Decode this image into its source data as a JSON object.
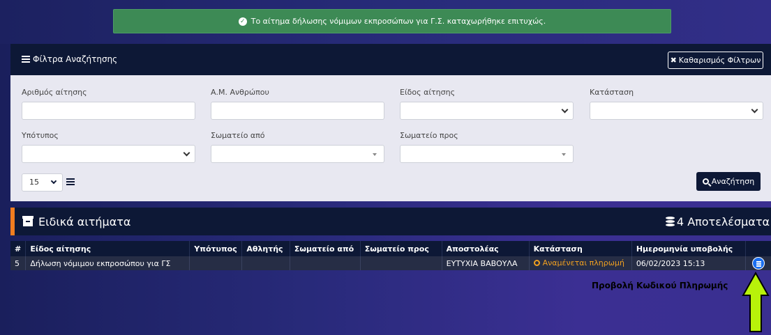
{
  "alert": {
    "message": "Το αίτημα δήλωσης νόμιμων εκπροσώπων για Γ.Σ. καταχωρήθηκε επιτυχώς.",
    "color": "#3d8a55"
  },
  "filters": {
    "title": "Φίλτρα Αναζήτησης",
    "clear_label": "Καθαρισμός Φίλτρων",
    "fields": {
      "request_number": {
        "label": "Αριθμός αίτησης",
        "value": ""
      },
      "person_id": {
        "label": "Α.Μ. Ανθρώπου",
        "value": ""
      },
      "request_type": {
        "label": "Είδος αίτησης",
        "value": ""
      },
      "status": {
        "label": "Κατάσταση",
        "value": ""
      },
      "subtype": {
        "label": "Υπότυπος",
        "value": ""
      },
      "club_from": {
        "label": "Σωματείο από",
        "value": ""
      },
      "club_to": {
        "label": "Σωματείο προς",
        "value": ""
      }
    },
    "page_size": "15",
    "search_label": "Αναζήτηση"
  },
  "results": {
    "title": "Ειδικά αιτήματα",
    "count_label": "4 Αποτελέσματα",
    "accent": "#f07d1f",
    "columns": [
      "#",
      "Είδος αίτησης",
      "Υπότυπος",
      "Αθλητής",
      "Σωματείο από",
      "Σωματείο προς",
      "Αποστολέας",
      "Κατάσταση",
      "Ημερομηνία υποβολής",
      ""
    ],
    "rows": [
      {
        "id": "5",
        "type": "Δήλωση νόμιμου εκπροσώπου για ΓΣ",
        "subtype": "",
        "athlete": "",
        "club_from": "",
        "club_to": "",
        "sender": "ΕΥΤΥΧΙΑ ΒΑΒΟΥΛΑ",
        "status": "Αναμένεται πληρωμή",
        "submitted": "06/02/2023 15:13"
      }
    ]
  },
  "annotation": {
    "text": "Προβολή Κωδικού Πληρωμής",
    "arrow_color": "#b8f20a"
  }
}
